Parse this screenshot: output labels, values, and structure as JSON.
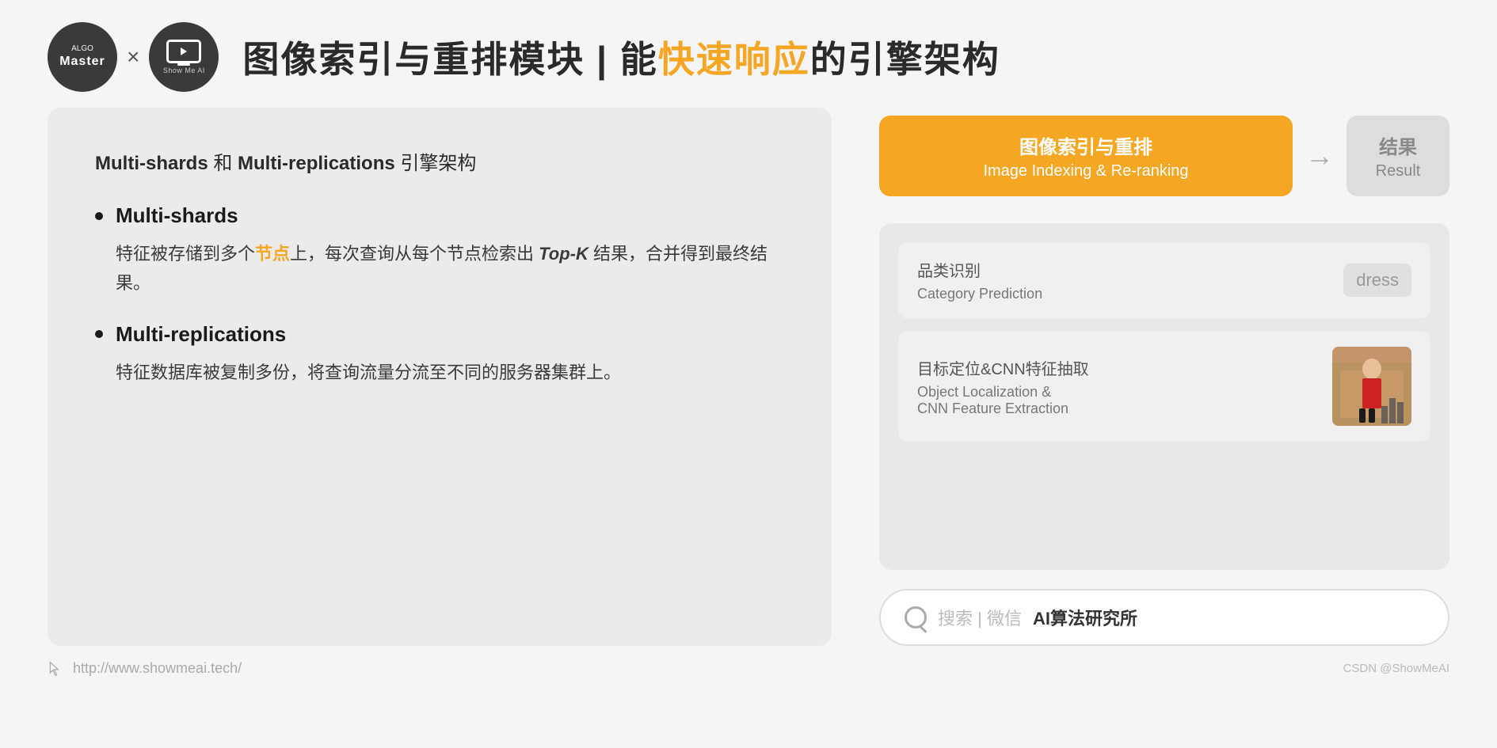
{
  "header": {
    "algo_logo": {
      "line1": "ALGO",
      "line2": "Master"
    },
    "times": "×",
    "showme_logo": "Show Me AI",
    "title": {
      "prefix": "图像索引与重排模块 | 能",
      "highlight": "快速响应",
      "suffix": "的引擎架构"
    }
  },
  "left_panel": {
    "subtitle": {
      "bold1": "Multi-shards",
      "and": " 和 ",
      "bold2": "Multi-replications",
      "suffix": " 引擎架构"
    },
    "bullets": [
      {
        "title": "Multi-shards",
        "description_parts": [
          "特征被存储到多个",
          "节点",
          "上，每次查询从每个节点检索出 ",
          "Top-K",
          " 结果，合并得到最终结果。"
        ],
        "has_orange": true,
        "has_bold_en": true
      },
      {
        "title": "Multi-replications",
        "description": "特征数据库被复制多份，将查询流量分流至不同的服务器集群上。"
      }
    ]
  },
  "right_panel": {
    "flow": {
      "box1_zh": "图像索引与重排",
      "box1_en": "Image Indexing & Re-ranking",
      "arrow": "→",
      "box2_zh": "结果",
      "box2_en": "Result"
    },
    "processing": {
      "cards": [
        {
          "zh": "品类识别",
          "en": "Category Prediction",
          "result": "dress",
          "has_image": false
        },
        {
          "zh": "目标定位&CNN特征抽取",
          "en": "Object Localization &\nCNN Feature Extraction",
          "result": "",
          "has_image": true
        }
      ]
    },
    "search_bar": {
      "search_icon": "search",
      "divider": "搜索 | 微信",
      "brand": "AI算法研究所"
    }
  },
  "footer": {
    "url": "http://www.showmeai.tech/",
    "credit": "CSDN @ShowMeAI"
  }
}
